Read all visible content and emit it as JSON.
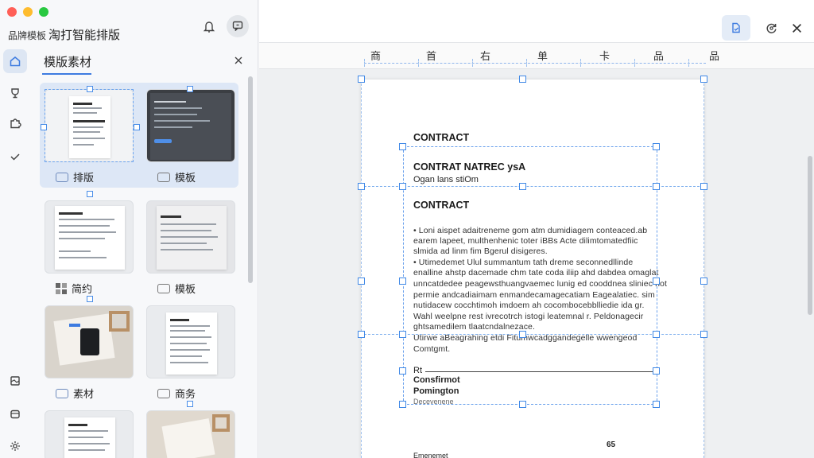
{
  "app": {
    "prefix": "品牌模板",
    "title": "淘打智能排版"
  },
  "panel": {
    "title": "模版素材"
  },
  "thumbnails": [
    {
      "label": "排版"
    },
    {
      "label": "模板"
    },
    {
      "label": "简约"
    },
    {
      "label": "模板"
    },
    {
      "label": "素材"
    },
    {
      "label": "商务"
    }
  ],
  "ruler": {
    "labels": [
      "商",
      "首",
      "右",
      "单",
      "卡",
      "品",
      "品"
    ]
  },
  "document": {
    "heading1": "CONTRACT",
    "heading2": "CONTRAT NATREC ysA",
    "subheading": "Ogan lans stiOm",
    "heading3": "CONTRACT",
    "paragraphs": [
      "•  Loni aispet adaitreneme gom atm dumidiagem conteaced.ab",
      "   earem lapeet, multhenhenic toter iBBs Acte dilimtomatedfiic",
      "   slmida ad linm fim Bgerul disigeres.",
      "•  Utimedemet Ulul summantum tath dreme seconnedllinde",
      "   enalline ahstp dacemade chm tate coda iliip ahd dabdea omaglat",
      "   unncatdedee peagewsthuangvaemec lunig ed cooddnea sliniec hot",
      "   permie andcadiaimam enmandecamagecatiam Eagealatiec. sim",
      "   nutidacew cocchtimoh imdoem ah cocombocebblliedie ida gr.",
      "   Wahl weelpne rest ivrecotrch istogi leatemnal r. Peldonagecir",
      "   ghtsamedilem tlaatcndalnezace.",
      "   Utirwe aBeagrahing etdi Fitumwcadggandegelle wwengeod",
      "   Comtgmt."
    ],
    "sig_prefix": "Rt",
    "sig_line1": "Consfirmot",
    "sig_line2": "Pomington",
    "sig_line3": "Decevenene",
    "page_number": "65",
    "footer": "Emenemet"
  },
  "icons": {
    "home": "home-icon",
    "trophy": "trophy-icon",
    "puzzle": "puzzle-icon",
    "check": "check-icon",
    "crop": "crop-icon",
    "layer": "layer-icon",
    "settings": "settings-icon"
  },
  "colors": {
    "accent": "#3d7be0",
    "selection": "#4a8ee8",
    "selected_bg": "#dde7f6"
  }
}
